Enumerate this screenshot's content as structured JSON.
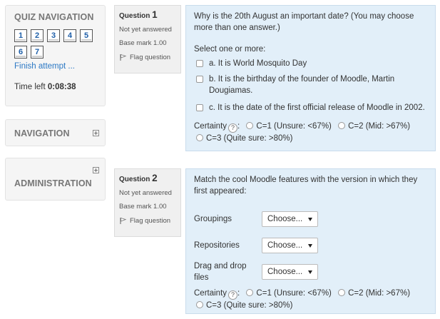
{
  "quiz_nav": {
    "title": "QUIZ NAVIGATION",
    "numbers": [
      "1",
      "2",
      "3",
      "4",
      "5",
      "6",
      "7"
    ],
    "finish_label": "Finish attempt ...",
    "time_left_label": "Time left",
    "time_left_value": "0:08:38"
  },
  "navigation": {
    "title": "NAVIGATION"
  },
  "administration": {
    "title": "ADMINISTRATION"
  },
  "questions": [
    {
      "label": "Question",
      "number": "1",
      "state": "Not yet answered",
      "grade": "Base mark 1.00",
      "flag": "Flag question",
      "text": "Why is the 20th August an important date? (You may choose more than one answer.)",
      "prompt": "Select one or more:",
      "options": [
        "a. It is World Mosquito Day",
        "b. It is the birthday of the founder of Moodle, Martin Dougiamas.",
        "c. It is the date of the first official release of Moodle in 2002."
      ],
      "certainty": {
        "label": "Certainty",
        "options": [
          "C=1 (Unsure: <67%)",
          "C=2 (Mid: >67%)",
          "C=3 (Quite sure: >80%)"
        ]
      }
    },
    {
      "label": "Question",
      "number": "2",
      "state": "Not yet answered",
      "grade": "Base mark 1.00",
      "flag": "Flag question",
      "text": "Match the cool Moodle features with the version in which they first appeared:",
      "rows": [
        {
          "label": "Groupings",
          "value": "Choose..."
        },
        {
          "label": "Repositories",
          "value": "Choose..."
        },
        {
          "label": "Drag and drop files",
          "value": "Choose..."
        }
      ],
      "certainty": {
        "label": "Certainty",
        "options": [
          "C=1 (Unsure: <67%)",
          "C=2 (Mid: >67%)",
          "C=3 (Quite sure: >80%)"
        ]
      }
    }
  ]
}
